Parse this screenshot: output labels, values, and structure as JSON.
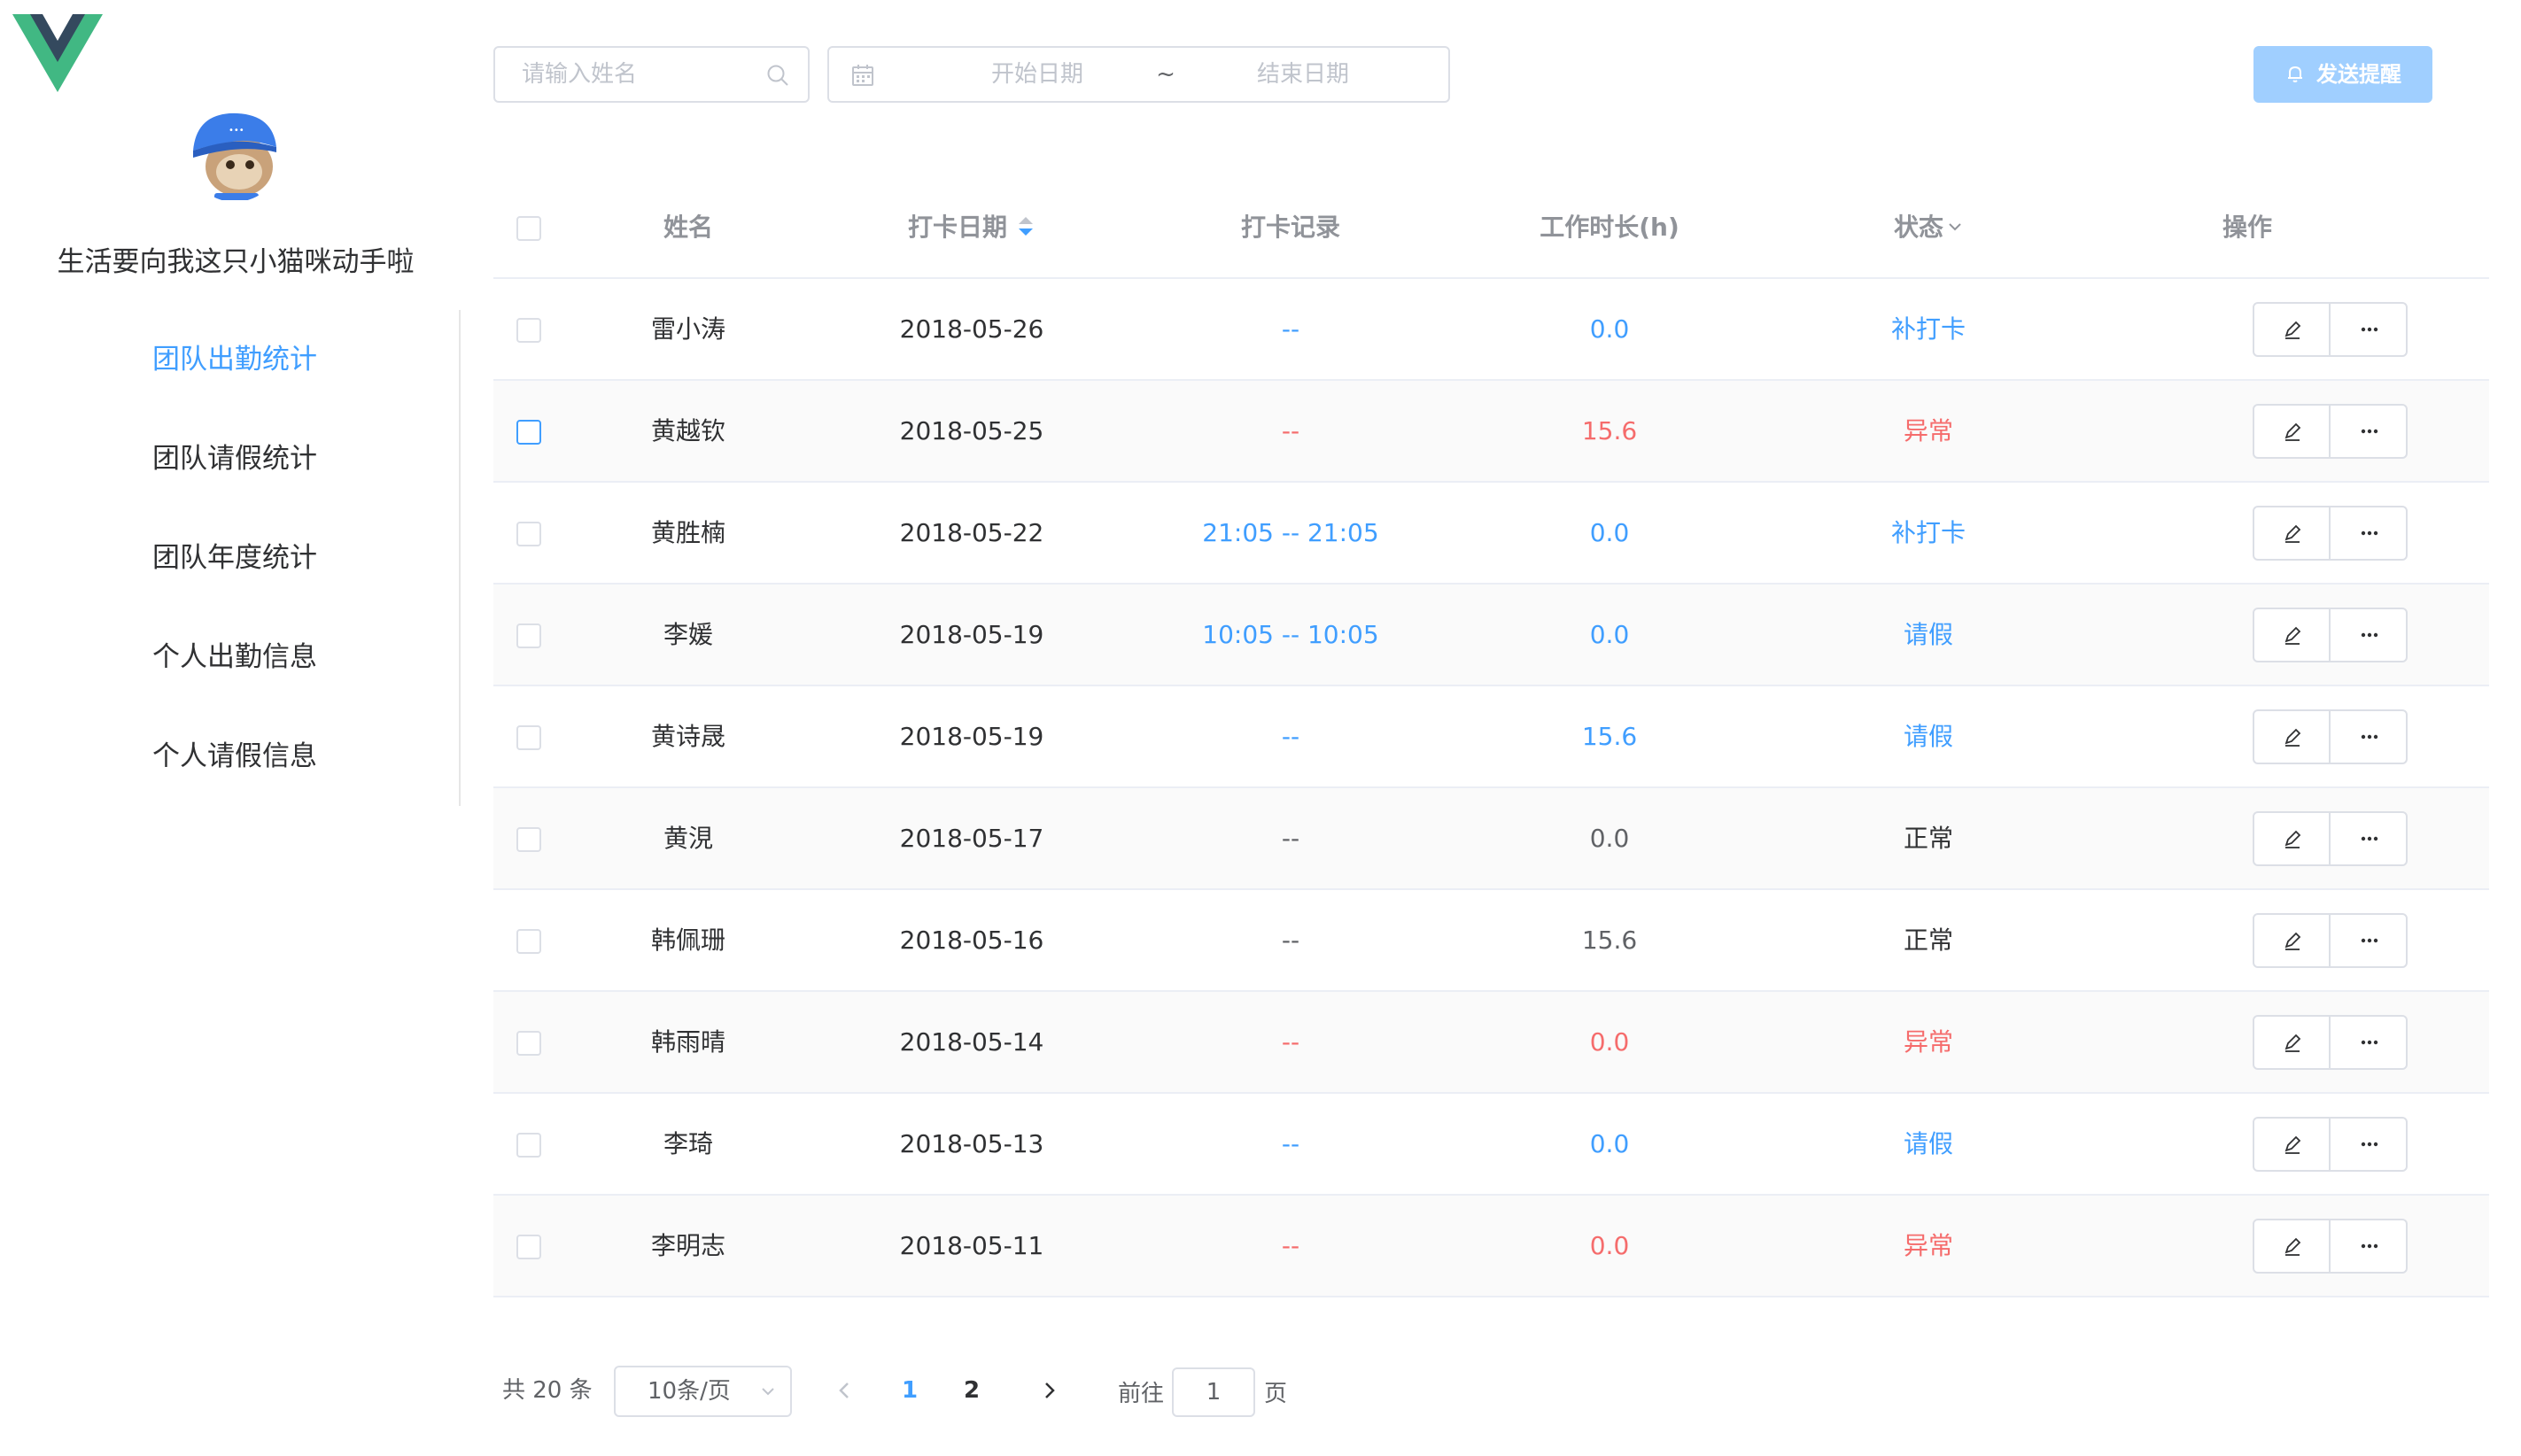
{
  "sidebar": {
    "profile_name": "生活要向我这只小猫咪动手啦",
    "menu": [
      {
        "label": "团队出勤统计",
        "active": true
      },
      {
        "label": "团队请假统计",
        "active": false
      },
      {
        "label": "团队年度统计",
        "active": false
      },
      {
        "label": "个人出勤信息",
        "active": false
      },
      {
        "label": "个人请假信息",
        "active": false
      }
    ]
  },
  "toolbar": {
    "search_placeholder": "请输入姓名",
    "start_placeholder": "开始日期",
    "range_separator": "~",
    "end_placeholder": "结束日期",
    "remind_label": "发送提醒"
  },
  "table": {
    "headers": {
      "name": "姓名",
      "date": "打卡日期",
      "record": "打卡记录",
      "hours": "工作时长(h)",
      "status": "状态",
      "ops": "操作"
    },
    "rows": [
      {
        "name": "雷小涛",
        "date": "2018-05-26",
        "record": "--",
        "hours": "0.0",
        "status": "补打卡",
        "tone": "blue",
        "striped": false,
        "checkbox_hover": false
      },
      {
        "name": "黄越钦",
        "date": "2018-05-25",
        "record": "--",
        "hours": "15.6",
        "status": "异常",
        "tone": "red",
        "striped": true,
        "checkbox_hover": true
      },
      {
        "name": "黄胜楠",
        "date": "2018-05-22",
        "record": "21:05 -- 21:05",
        "hours": "0.0",
        "status": "补打卡",
        "tone": "blue",
        "striped": false,
        "checkbox_hover": false
      },
      {
        "name": "李媛",
        "date": "2018-05-19",
        "record": "10:05 -- 10:05",
        "hours": "0.0",
        "status": "请假",
        "tone": "blue",
        "striped": true,
        "checkbox_hover": false
      },
      {
        "name": "黄诗晟",
        "date": "2018-05-19",
        "record": "--",
        "hours": "15.6",
        "status": "请假",
        "tone": "blue",
        "striped": false,
        "checkbox_hover": false
      },
      {
        "name": "黄涀",
        "date": "2018-05-17",
        "record": "--",
        "hours": "0.0",
        "status": "正常",
        "tone": "normal",
        "striped": true,
        "checkbox_hover": false
      },
      {
        "name": "韩佩珊",
        "date": "2018-05-16",
        "record": "--",
        "hours": "15.6",
        "status": "正常",
        "tone": "normal",
        "striped": false,
        "checkbox_hover": false
      },
      {
        "name": "韩雨晴",
        "date": "2018-05-14",
        "record": "--",
        "hours": "0.0",
        "status": "异常",
        "tone": "red",
        "striped": true,
        "checkbox_hover": false
      },
      {
        "name": "李琦",
        "date": "2018-05-13",
        "record": "--",
        "hours": "0.0",
        "status": "请假",
        "tone": "blue",
        "striped": false,
        "checkbox_hover": false
      },
      {
        "name": "李明志",
        "date": "2018-05-11",
        "record": "--",
        "hours": "0.0",
        "status": "异常",
        "tone": "red",
        "striped": true,
        "checkbox_hover": false
      }
    ]
  },
  "pagination": {
    "total_text": "共 20 条",
    "page_size": "10条/页",
    "pages": [
      "1",
      "2"
    ],
    "current_page": "1",
    "goto_prefix": "前往",
    "goto_value": "1",
    "goto_suffix": "页"
  },
  "icons": {
    "logo": "vue-logo-icon",
    "search": "search-icon",
    "calendar": "calendar-icon",
    "bell": "bell-icon",
    "sort": "sort-caret-icon",
    "filter": "chevron-down-icon",
    "edit": "edit-icon",
    "more": "more-icon",
    "prev": "chevron-left-icon",
    "next": "chevron-right-icon"
  },
  "colors": {
    "accent": "#409eff",
    "danger": "#f56c6c",
    "remind_button": "#a0cfff",
    "vue_green": "#41b883",
    "vue_dark": "#34495e"
  }
}
